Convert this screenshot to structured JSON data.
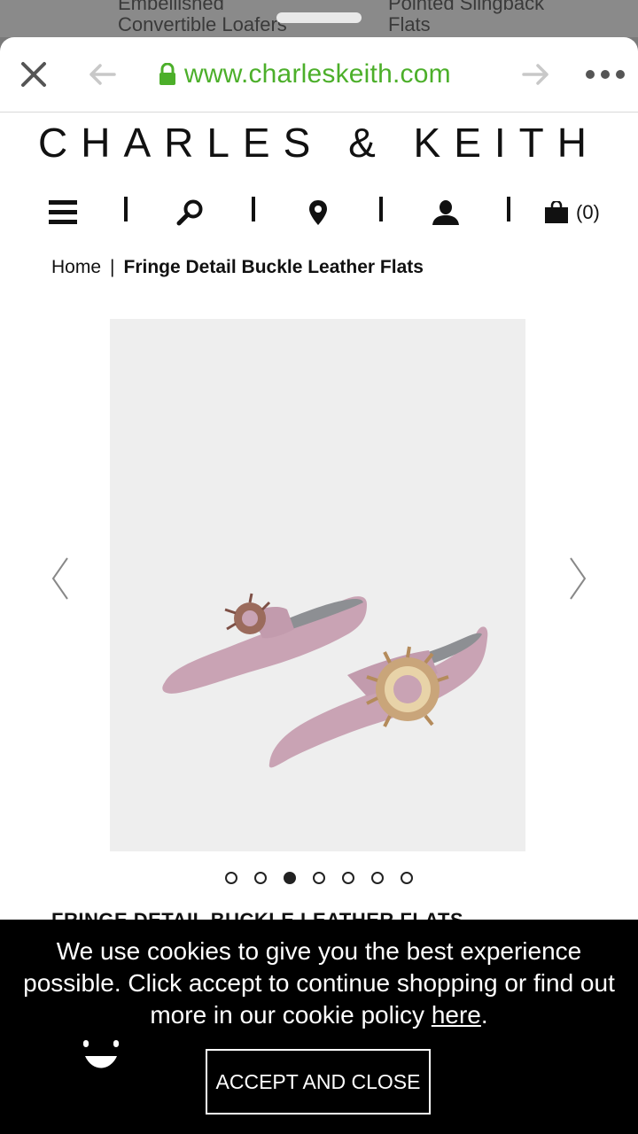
{
  "behind": {
    "item1": "Embellished\nConvertible Loafers",
    "item2": "Pointed Slingback\nFlats"
  },
  "browser": {
    "url": "www.charleskeith.com",
    "close_icon": "close-icon",
    "back_icon": "arrow-left-icon",
    "forward_icon": "arrow-right-icon",
    "more_icon": "more-icon",
    "secure_color": "#4caf2a"
  },
  "brand": "CHARLES & KEITH",
  "nav": {
    "cart_count": "(0)",
    "icons": [
      "menu-icon",
      "search-icon",
      "location-pin-icon",
      "user-icon",
      "shopping-bag-icon"
    ]
  },
  "breadcrumb": {
    "home": "Home",
    "separator": "|",
    "current": "Fringe Detail Buckle Leather Flats"
  },
  "gallery": {
    "dot_count": 7,
    "active_index": 2,
    "shoe_color": "#c9a3b4"
  },
  "product": {
    "title": "FRINGE DETAIL BUCKLE LEATHER FLATS"
  },
  "cookie": {
    "message_prefix": "We use cookies to give you the best experience possible. Click accept to continue shopping or find out more in our cookie policy ",
    "link": "here",
    "message_suffix": ".",
    "accept_label": "ACCEPT AND CLOSE"
  }
}
